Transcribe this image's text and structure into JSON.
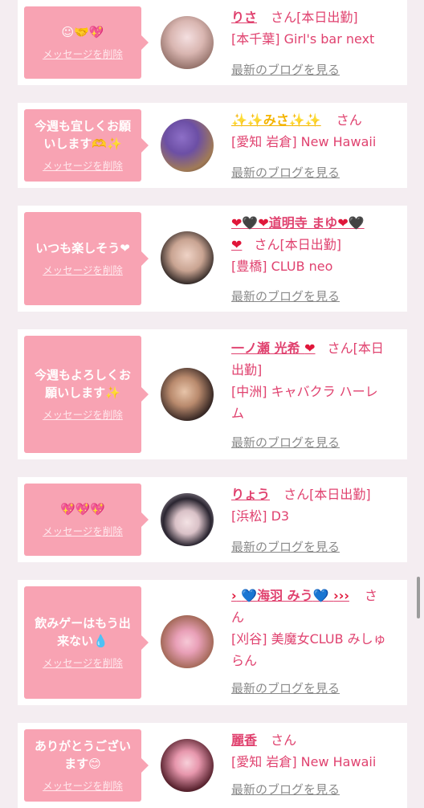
{
  "cards": [
    {
      "message": "☺🤝💖",
      "delete_label": "メッセージを削除",
      "name": "りさ",
      "san": "さん",
      "status": "[本日出勤]",
      "shop": "[本千葉] Girl's bar next",
      "blog_label": "最新のブログを見る"
    },
    {
      "message": "今週も宜しくお願いします🫶✨",
      "delete_label": "メッセージを削除",
      "name": "✨✨みさ✨✨",
      "san": "さん",
      "status": "",
      "shop": "[愛知 岩倉] New Hawaii",
      "blog_label": "最新のブログを見る"
    },
    {
      "message": "いつも楽しそう❤",
      "delete_label": "メッセージを削除",
      "name_parts": [
        "❤🖤❤",
        "道明寺 まゆ",
        "❤🖤",
        "❤"
      ],
      "san": "さん",
      "status": "[本日出勤]",
      "shop": "[豊橋] CLUB neo",
      "blog_label": "最新のブログを見る"
    },
    {
      "message": "今週もよろしくお願いします✨",
      "delete_label": "メッセージを削除",
      "name_parts": [
        "一ノ瀬 光希 ",
        "❤"
      ],
      "san": "さん",
      "status_a": "[本日",
      "status_b": "出勤]",
      "shop_a": "[中洲] キャバクラ ハーレ",
      "shop_b": "ム",
      "blog_label": "最新のブログを見る"
    },
    {
      "message": "💖💖💖",
      "delete_label": "メッセージを削除",
      "name": "りょう",
      "san": "さん",
      "status": "[本日出勤]",
      "shop": "[浜松] D3",
      "blog_label": "最新のブログを見る"
    },
    {
      "message": "飲みゲーはもう出来ない💧",
      "delete_label": "メッセージを削除",
      "name_parts": [
        "›",
        "💙",
        "海羽 みう",
        "💙",
        "›››"
      ],
      "san_a": "さ",
      "san_b": "ん",
      "shop_a": "[刈谷] 美魔女CLUB みしゅ",
      "shop_b": "らん",
      "blog_label": "最新のブログを見る"
    },
    {
      "message": "ありがとうございます😊",
      "delete_label": "メッセージを削除",
      "name": "麗香",
      "san": "さん",
      "shop": "[愛知 岩倉] New Hawaii",
      "blog_label": "最新のブログを見る"
    }
  ]
}
